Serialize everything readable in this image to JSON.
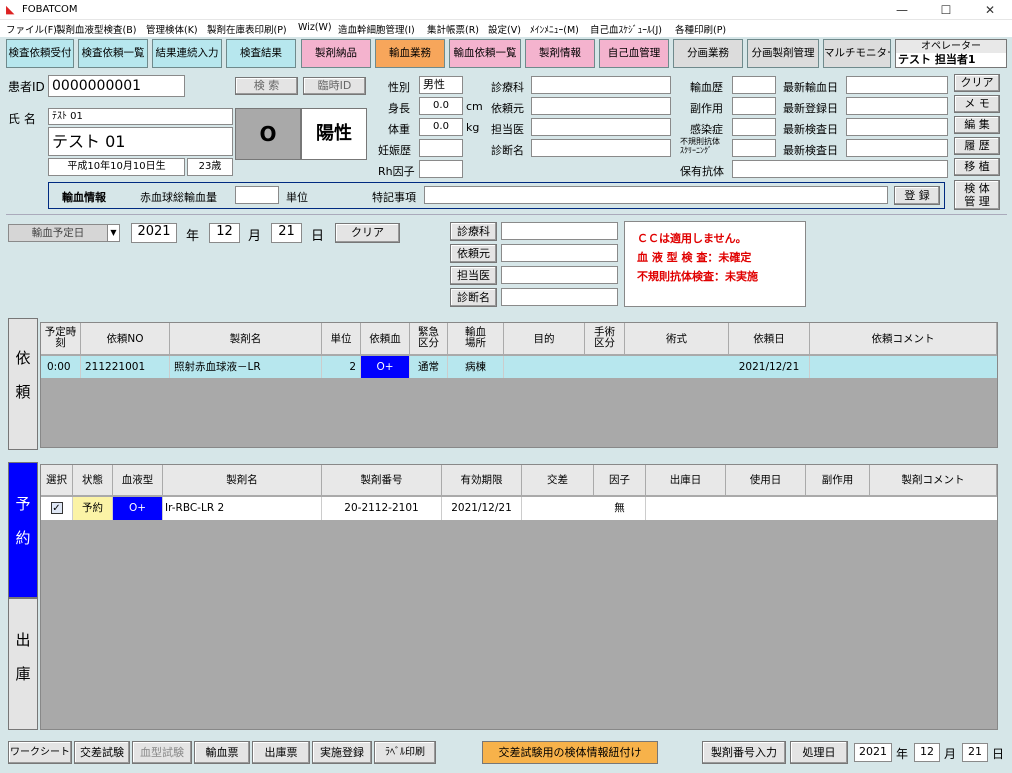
{
  "window": {
    "title": "FOBATCOM",
    "min": "—",
    "max": "☐",
    "close": "✕"
  },
  "menu": [
    "ファイル(F)",
    "製剤血液型検査(B)",
    "管理検体(K)",
    "製剤在庫表印刷(P)",
    "Wiz(W)",
    "造血幹細胞管理(I)",
    "集計帳票(R)",
    "設定(V)",
    "ﾒｲﾝﾒﾆｭｰ(M)",
    "自己血ｽｹｼﾞｭｰﾙ(J)",
    "各種印刷(P)"
  ],
  "top_buttons": [
    "検査依頼受付",
    "検査依頼一覧",
    "結果連続入力",
    "検査結果",
    "製剤納品",
    "輸血業務",
    "輸血依頼一覧",
    "製剤情報",
    "自己血管理",
    "分画業務",
    "分画製剤管理",
    "マルチモニター"
  ],
  "operator": {
    "label": "オペレーター",
    "name": "テスト 担当者1"
  },
  "patient": {
    "id_label": "患者ID",
    "id": "0000000001",
    "search": "検 索",
    "temp_id": "臨時ID",
    "name_label": "氏 名",
    "kana": "ﾃｽﾄ 01",
    "name": "テスト 01",
    "birth": "平成10年10月10日生",
    "age": "23歳",
    "abo": "O",
    "rh": "陽性"
  },
  "vitals": {
    "sex_label": "性別",
    "sex": "男性",
    "height_label": "身長",
    "height": "0.0",
    "height_unit": "cm",
    "weight_label": "体重",
    "weight": "0.0",
    "weight_unit": "kg",
    "preg_label": "妊娠歴",
    "rh_label": "Rh因子"
  },
  "clinic": {
    "dept": "診療科",
    "origin": "依頼元",
    "doctor": "担当医",
    "diag": "診断名"
  },
  "history": {
    "transfusion": "輸血歴",
    "side_effect": "副作用",
    "infection": "感染症",
    "irregular1": "不規則抗体",
    "irregular2": "ｽｸﾘｰﾆﾝｸﾞ",
    "holding": "保有抗体",
    "latest_tx": "最新輸血日",
    "latest_reg": "最新登録日",
    "latest_test1": "最新検査日",
    "latest_test2": "最新検査日"
  },
  "side_buttons": [
    "クリア",
    "メ モ",
    "編 集",
    "履 歴",
    "移 植"
  ],
  "side_mgmt": [
    "検 体",
    "管 理"
  ],
  "tx_info": {
    "title": "輸血情報",
    "rbc_label": "赤血球総輸血量",
    "unit": "単位",
    "note_label": "特記事項",
    "register": "登 録"
  },
  "schedule": {
    "select": "輸血予定日",
    "year": "2021",
    "year_lbl": "年",
    "month": "12",
    "month_lbl": "月",
    "day": "21",
    "day_lbl": "日",
    "clear": "クリア",
    "dept": "診療科",
    "origin": "依頼元",
    "doctor": "担当医",
    "diag": "診断名"
  },
  "alerts": [
    "ＣＣは適用しません。",
    "血 液 型 検 査：未確定",
    "不規則抗体検査：未実施"
  ],
  "request_tab": [
    "依",
    "頼"
  ],
  "request_headers": [
    "予定時刻",
    "依頼NO",
    "製剤名",
    "単位",
    "依頼血",
    "緊急区分",
    "輸血場所",
    "目的",
    "手術区分",
    "術式",
    "依頼日",
    "依頼コメント"
  ],
  "request_rows": [
    {
      "time": "0:00",
      "no": "211221001",
      "product": "照射赤血球液－LR",
      "units": "2",
      "blood": "O+",
      "urgent": "通常",
      "place": "病棟",
      "purpose": "",
      "surgery": "",
      "method": "",
      "date": "2021/12/21",
      "comment": ""
    }
  ],
  "reserve_tab": [
    "予",
    "約"
  ],
  "issue_tab": [
    "出",
    "庫"
  ],
  "reserve_headers": [
    "選択",
    "状態",
    "血液型",
    "製剤名",
    "製剤番号",
    "有効期限",
    "交差",
    "因子",
    "出庫日",
    "使用日",
    "副作用",
    "製剤コメント"
  ],
  "reserve_rows": [
    {
      "checked": "✓",
      "status": "予約",
      "blood": "O+",
      "product": "Ir-RBC-LR 2",
      "number": "20-2112-2101",
      "expiry": "2021/12/21",
      "cross": "",
      "factor": "無",
      "out": "",
      "use": "",
      "side": "",
      "comment": ""
    }
  ],
  "bottom_buttons": [
    "ワークシート",
    "交差試験",
    "血型試験",
    "輸血票",
    "出庫票",
    "実施登録",
    "ﾗﾍﾞﾙ印刷"
  ],
  "bottom_orange": "交差試験用の検体情報紐付け",
  "bottom_right": {
    "serial": "製剤番号入力",
    "process": "処理日",
    "year": "2021",
    "year_lbl": "年",
    "month": "12",
    "month_lbl": "月",
    "day": "21",
    "day_lbl": "日"
  },
  "colors": {
    "bg": "#d6e6e8",
    "blue": "#0000ff",
    "cyan": "#b7e7ee",
    "pink": "#f4b3ce",
    "orange": "#f7a65b",
    "row_sel": "#b7e7ee"
  }
}
